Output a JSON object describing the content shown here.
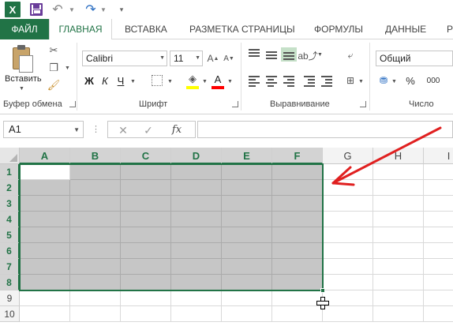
{
  "quick_access": {
    "logo_text": "X",
    "undo_icon": "undo-icon",
    "redo_icon": "redo-icon"
  },
  "tabs": [
    {
      "label": "ФАЙЛ"
    },
    {
      "label": "ГЛАВНАЯ"
    },
    {
      "label": "ВСТАВКА"
    },
    {
      "label": "РАЗМЕТКА СТРАНИЦЫ"
    },
    {
      "label": "ФОРМУЛЫ"
    },
    {
      "label": "ДАННЫЕ"
    },
    {
      "label": "Р"
    }
  ],
  "ribbon": {
    "clipboard": {
      "paste_label": "Вставить",
      "group_label": "Буфер обмена"
    },
    "font": {
      "font_name": "Calibri",
      "font_size": "11",
      "bold": "Ж",
      "italic": "К",
      "underline": "Ч",
      "group_label": "Шрифт",
      "fill_color": "#ffff00",
      "font_color": "#ff0000"
    },
    "alignment": {
      "group_label": "Выравнивание"
    },
    "number": {
      "format": "Общий",
      "percent": "%",
      "group_label": "Число"
    }
  },
  "formula_bar": {
    "name_box": "A1",
    "cancel": "✕",
    "enter": "✓",
    "fx": "fx",
    "value": ""
  },
  "sheet": {
    "columns": [
      "A",
      "B",
      "C",
      "D",
      "E",
      "F",
      "G",
      "H",
      "I"
    ],
    "rows": [
      "1",
      "2",
      "3",
      "4",
      "5",
      "6",
      "7",
      "8",
      "9",
      "10"
    ],
    "selection": "A1:F8",
    "accent_color": "#217346",
    "annotation_arrow_color": "#e02020"
  }
}
